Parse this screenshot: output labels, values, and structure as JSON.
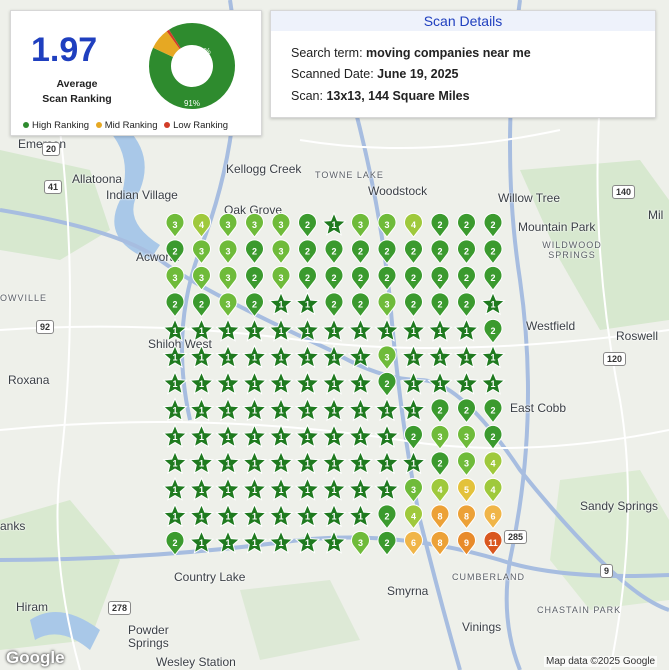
{
  "summary": {
    "average_score": "1.97",
    "average_label_line1": "Average",
    "average_label_line2": "Scan Ranking",
    "donut": {
      "high_percent": 91,
      "mid_percent": 8,
      "low_percent": 1,
      "high_label": "91%",
      "mid_label": "8%"
    },
    "legend": [
      {
        "label": "High Ranking",
        "color": "#2e8b2e"
      },
      {
        "label": "Mid Ranking",
        "color": "#e6a823"
      },
      {
        "label": "Low Ranking",
        "color": "#d23c27"
      }
    ]
  },
  "details": {
    "title": "Scan Details",
    "search_label": "Search term: ",
    "search_value": "moving companies near me",
    "date_label": "Scanned Date: ",
    "date_value": "June 19, 2025",
    "scan_label": "Scan: ",
    "scan_value": "13x13, 144 Square Miles"
  },
  "map_places": [
    "Emerson",
    "Allatoona",
    "Indian Village",
    "Kellogg Creek",
    "TOWNE LAKE",
    "Woodstock",
    "Willow Tree",
    "Oak Grove",
    "Mountain Park",
    "WILDWOOD SPRINGS",
    "Acworth",
    "OWVILLE",
    "Shiloh West",
    "Westfield",
    "Roswell",
    "Roxana",
    "East Cobb",
    "Sandy Springs",
    "Country Lake",
    "Smyrna",
    "CUMBERLAND",
    "Hiram",
    "CHASTAIN PARK",
    "Powder Springs",
    "Vinings",
    "Wesley Station",
    "anks",
    "Mil"
  ],
  "road_shields": [
    "41",
    "92",
    "20",
    "140",
    "9",
    "120",
    "278",
    "285"
  ],
  "footer": {
    "brand": "Google",
    "copyright": "Map data ©2025 Google"
  },
  "colors": {
    "rank_1": "#1f7a1f",
    "rank_2": "#3b9a2e",
    "rank_3": "#6fbb3a",
    "rank_4": "#9fc93c",
    "rank_5": "#e3c23b",
    "rank_6": "#f0b548",
    "rank_8": "#eca137",
    "rank_9": "#e88b2b",
    "rank_11": "#d9571f"
  },
  "grid": {
    "size": 13,
    "ranks": [
      [
        3,
        4,
        3,
        3,
        3,
        2,
        1,
        3,
        3,
        4,
        2,
        2,
        2
      ],
      [
        2,
        3,
        3,
        2,
        3,
        2,
        2,
        2,
        2,
        2,
        2,
        2,
        2
      ],
      [
        3,
        3,
        3,
        2,
        3,
        2,
        2,
        2,
        2,
        2,
        2,
        2,
        2
      ],
      [
        2,
        2,
        3,
        2,
        1,
        1,
        2,
        2,
        3,
        2,
        2,
        2,
        1
      ],
      [
        1,
        1,
        1,
        1,
        1,
        1,
        1,
        1,
        1,
        1,
        1,
        1,
        2
      ],
      [
        1,
        1,
        1,
        1,
        1,
        1,
        1,
        1,
        3,
        1,
        1,
        1,
        1
      ],
      [
        1,
        1,
        1,
        1,
        1,
        1,
        1,
        1,
        2,
        1,
        1,
        1,
        1
      ],
      [
        1,
        1,
        1,
        1,
        1,
        1,
        1,
        1,
        1,
        1,
        2,
        2,
        2
      ],
      [
        1,
        1,
        1,
        1,
        1,
        1,
        1,
        1,
        1,
        2,
        3,
        3,
        2
      ],
      [
        1,
        1,
        1,
        1,
        1,
        1,
        1,
        1,
        1,
        1,
        2,
        3,
        4
      ],
      [
        1,
        1,
        1,
        1,
        1,
        1,
        1,
        1,
        1,
        3,
        4,
        5,
        4
      ],
      [
        1,
        1,
        1,
        1,
        1,
        1,
        1,
        1,
        2,
        4,
        8,
        8,
        6
      ],
      [
        2,
        1,
        1,
        1,
        1,
        1,
        1,
        3,
        2,
        6,
        8,
        9,
        11
      ]
    ]
  }
}
